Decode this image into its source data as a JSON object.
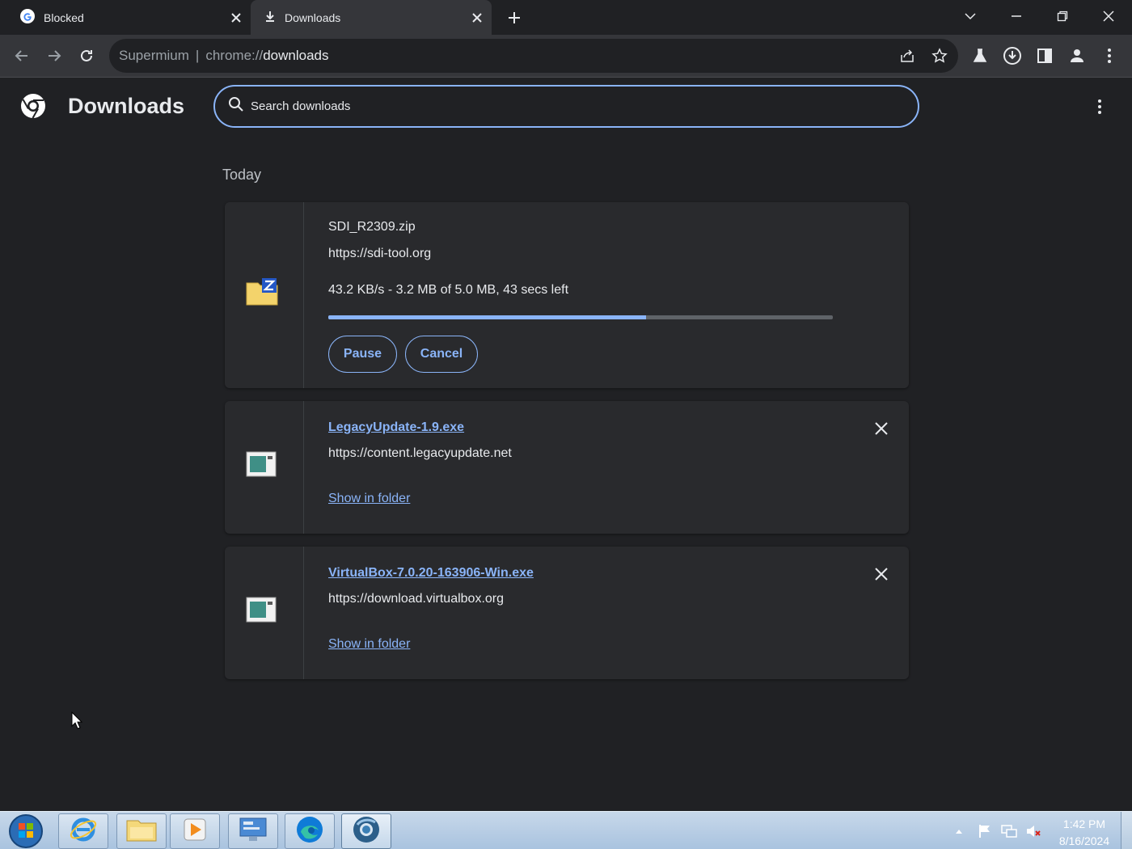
{
  "tabs": [
    {
      "title": "Blocked",
      "icon": "google-g-icon"
    },
    {
      "title": "Downloads",
      "icon": "download-icon",
      "active": true
    }
  ],
  "toolbar": {
    "site_label": "Supermium",
    "url_scheme": "chrome://",
    "url_path": "downloads"
  },
  "page": {
    "title": "Downloads",
    "search_placeholder": "Search downloads",
    "section": "Today"
  },
  "downloads": [
    {
      "filename": "SDI_R2309.zip",
      "url": "https://sdi-tool.org",
      "status": "43.2 KB/s - 3.2 MB of 5.0 MB, 43 secs left",
      "progress": 0.63,
      "pause_label": "Pause",
      "cancel_label": "Cancel",
      "icon": "zip-folder-icon"
    },
    {
      "filename": "LegacyUpdate-1.9.exe",
      "url": "https://content.legacyupdate.net",
      "action_label": "Show in folder",
      "icon": "exe-window-icon"
    },
    {
      "filename": "VirtualBox-7.0.20-163906-Win.exe",
      "url": "https://download.virtualbox.org",
      "action_label": "Show in folder",
      "icon": "exe-window-icon"
    }
  ],
  "taskbar": {
    "time": "1:42 PM",
    "date": "8/16/2024"
  },
  "colors": {
    "accent": "#8ab4f8",
    "background": "#202124",
    "card": "#292a2d",
    "toolbar": "#35363a"
  }
}
